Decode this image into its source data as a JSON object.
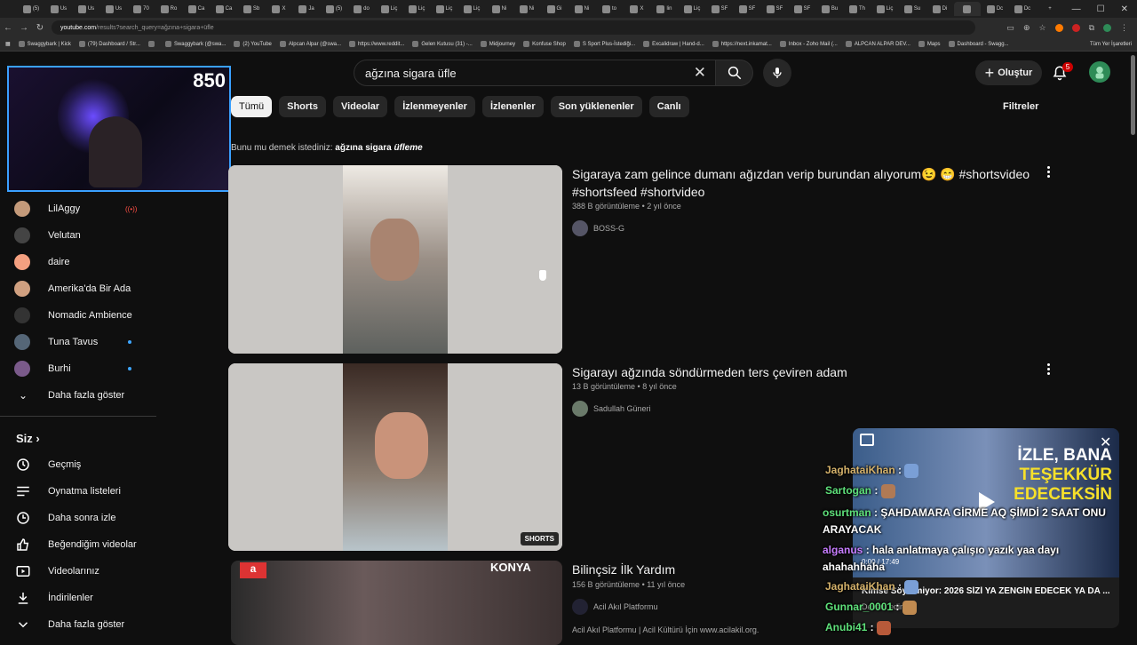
{
  "browser": {
    "tabs": [
      "(5)",
      "Us",
      "Us",
      "Us",
      "70",
      "Ro",
      "Ca",
      "Ca",
      "Sb",
      "X",
      "Ja",
      "(5)",
      "do",
      "Liç",
      "Liç",
      "Liç",
      "Liç",
      "Ni",
      "Ni",
      "Gi",
      "Ni",
      "to",
      "X",
      "lin",
      "Liç",
      "SF",
      "SF",
      "SF",
      "SF",
      "Bu",
      "Th",
      "Liç",
      "Su",
      "Di",
      "",
      "Dc",
      "Dc"
    ],
    "url_host": "youtube.com",
    "url_path": "/results?search_query=ağzına+sigara+üfle",
    "bookmarks": [
      "Swaggybark | Kick",
      "(79) Dashboard / Str...",
      "",
      "Swaggybark (@swa...",
      "(2) YouTube",
      "Alpcan Alpar (@swa...",
      "https://www.reddit...",
      "Gelen Kutusu (31) -...",
      "Midjourney",
      "Konfuse Shop",
      "S Sport Plus-İstediği...",
      "Excalidraw | Hand-d...",
      "https://next.inkamat...",
      "Inbox - Zoho Mail (...",
      "ALPCAN ALPAR DEV...",
      "Maps",
      "Dashboard - Swagg..."
    ],
    "all_bookmarks": "Tüm Yer İşaretleri"
  },
  "header": {
    "search_query": "ağzına sigara üfle",
    "create_label": "Oluştur",
    "notif_count": "5"
  },
  "chips": [
    "Tümü",
    "Shorts",
    "Videolar",
    "İzlenmeyenler",
    "İzlenenler",
    "Son yüklenenler",
    "Canlı"
  ],
  "filters_label": "Filtreler",
  "did_you_mean": {
    "prefix": "Bunu mu demek istediniz:",
    "bold": "ağzına sigara",
    "italic": "üfleme"
  },
  "webcam": {
    "counter": "850"
  },
  "sidebar": {
    "subscriptions": [
      {
        "label": "LilAggy",
        "live": true,
        "color": "#c49a7a"
      },
      {
        "label": "Velutan",
        "color": "#444444"
      },
      {
        "label": "daire",
        "color": "#f4a080"
      },
      {
        "label": "Amerika'da Bir Ada",
        "color": "#d0a080"
      },
      {
        "label": "Nomadic Ambience",
        "color": "#333333"
      },
      {
        "label": "Tuna Tavus",
        "new": true,
        "color": "#556677"
      },
      {
        "label": "Burhi",
        "new": true,
        "color": "#7a5a8a"
      }
    ],
    "show_more": "Daha fazla göster",
    "you_label": "Siz",
    "you_items": [
      "Geçmiş",
      "Oynatma listeleri",
      "Daha sonra izle",
      "Beğendiğim videolar",
      "Videolarınız",
      "İndirilenler",
      "Daha fazla göster"
    ]
  },
  "results": [
    {
      "title": "Sigaraya zam gelince dumanı ağızdan verip burundan alıyorum😉 😁 #shortsvideo #shortsfeed #shortvideo",
      "views": "388 B görüntüleme",
      "age": "2 yıl önce",
      "channel": "BOSS-G"
    },
    {
      "title": "Sigarayı ağzında söndürmeden ters çeviren adam",
      "views": "13 B görüntüleme",
      "age": "8 yıl önce",
      "channel": "Sadullah Güneri",
      "badge": "SHORTS"
    },
    {
      "title": "Bilinçsiz İlk Yardım",
      "views": "156 B görüntüleme",
      "age": "11 yıl önce",
      "channel": "Acil Akıl Platformu",
      "description": "Acil Akıl Platformu | Acil Kültürü İçin www.acilakil.org.",
      "thumb_text": "KONYA"
    }
  ],
  "miniplayer": {
    "overlay_line1": "İZLE, BANA",
    "overlay_line2": "TEŞEKKÜR",
    "overlay_line3": "EDECEKSİN",
    "title": "Kimse Söylemiyor: 2026 SİZİ YA ZENGİN EDECEK YA DA ...",
    "time": "0:00 / 17:49",
    "subtitle": "Devam edin"
  },
  "chat": [
    {
      "user": "JaghataiKhan",
      "msg": ""
    },
    {
      "user": "Sartogan",
      "msg": ""
    },
    {
      "user": "osurtman",
      "msg": "ŞAHDAMARA GİRME AQ ŞİMDİ 2 SAAT ONU ARAYACAK"
    },
    {
      "user": "alganus",
      "msg": "hala anlatmaya çalışıo yazık yaa dayı ahahahhaha"
    },
    {
      "user": "JaghataiKhan",
      "msg": ""
    },
    {
      "user": "Gunnar_0001",
      "msg": ""
    },
    {
      "user": "Anubi41",
      "msg": ""
    }
  ]
}
